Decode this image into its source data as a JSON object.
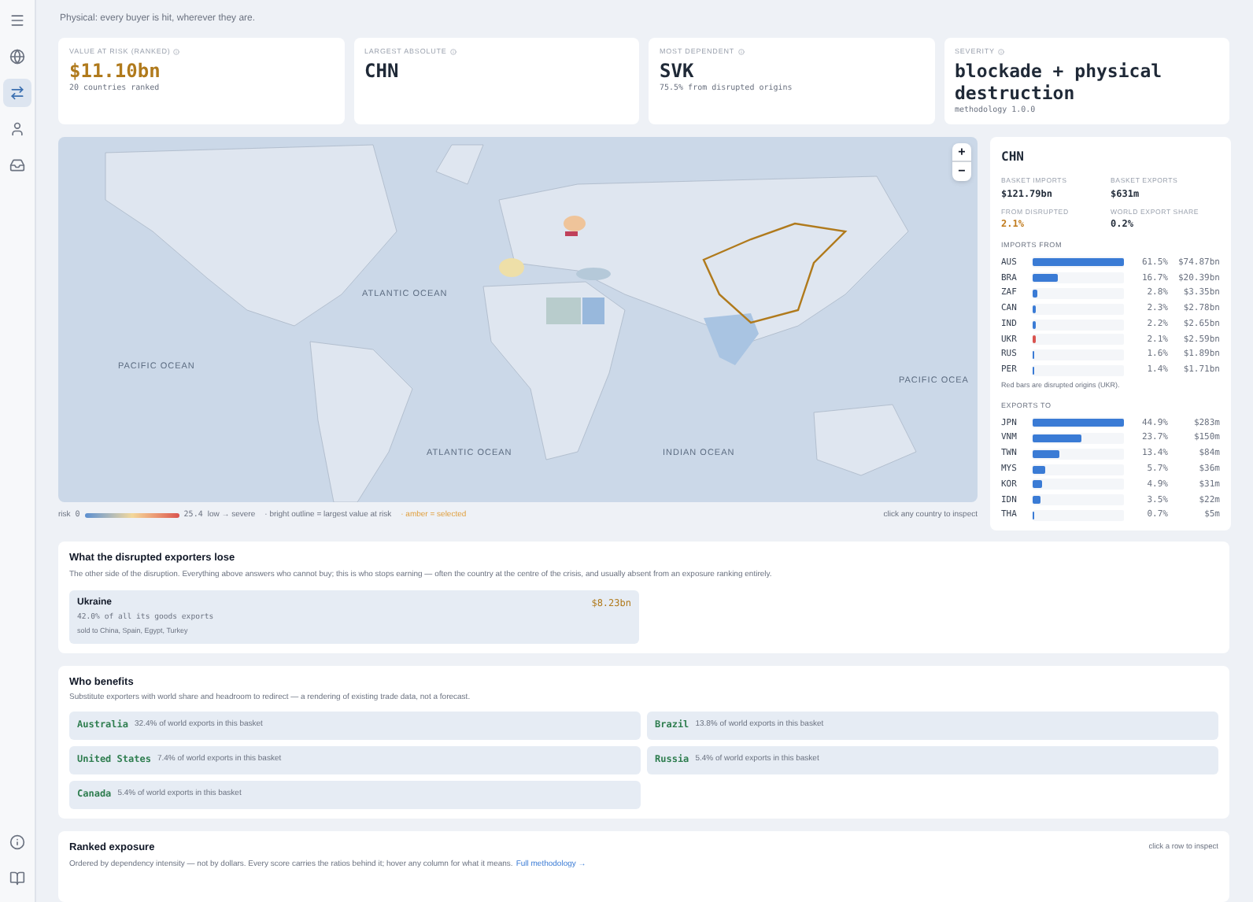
{
  "sidebar": {
    "items": [
      {
        "selected": false
      },
      {
        "selected": false
      },
      {
        "selected": true
      },
      {
        "selected": false
      },
      {
        "selected": false
      }
    ]
  },
  "intro": "Physical: every buyer is hit, wherever they are.",
  "stats": [
    {
      "label": "VALUE AT RISK (RANKED)",
      "value": "$11.10bn",
      "note": "20 countries ranked",
      "accent": true
    },
    {
      "label": "LARGEST ABSOLUTE",
      "value": "CHN",
      "accent": false
    },
    {
      "label": "MOST DEPENDENT",
      "value": "SVK",
      "note": "75.5% from disrupted origins",
      "accent": false
    },
    {
      "label": "SEVERITY",
      "value": "blockade + physical destruction",
      "note": "methodology 1.0.0",
      "accent": false
    }
  ],
  "map": {
    "zoom_in": "+",
    "zoom_out": "−",
    "oceans": [
      "ATLANTIC OCEAN",
      "PACIFIC OCEAN",
      "PACIFIC OCEA",
      "ATLANTIC OCEAN",
      "INDIAN OCEAN"
    ]
  },
  "legend": {
    "label": "risk",
    "min": "0",
    "max": "25.4",
    "scale": "low → severe",
    "outline_note": "· bright outline = largest value at risk",
    "selected_note": "· amber = selected",
    "hint": "click any country to inspect"
  },
  "detail": {
    "title": "CHN",
    "metrics": [
      {
        "label": "BASKET IMPORTS",
        "value": "$121.79bn",
        "accent": false
      },
      {
        "label": "BASKET EXPORTS",
        "value": "$631m",
        "accent": false
      },
      {
        "label": "FROM DISRUPTED",
        "value": "2.1%",
        "accent": true
      },
      {
        "label": "WORLD EXPORT SHARE",
        "value": "0.2%",
        "accent": false
      }
    ],
    "imports_title": "IMPORTS FROM",
    "imports": [
      {
        "code": "AUS",
        "level": 1.0,
        "share": "61.5%",
        "value": "$74.87bn",
        "disrupted": false
      },
      {
        "code": "BRA",
        "level": 0.27,
        "share": "16.7%",
        "value": "$20.39bn",
        "disrupted": false
      },
      {
        "code": "ZAF",
        "level": 0.05,
        "share": "2.8%",
        "value": "$3.35bn",
        "disrupted": false
      },
      {
        "code": "CAN",
        "level": 0.04,
        "share": "2.3%",
        "value": "$2.78bn",
        "disrupted": false
      },
      {
        "code": "IND",
        "level": 0.04,
        "share": "2.2%",
        "value": "$2.65bn",
        "disrupted": false
      },
      {
        "code": "UKR",
        "level": 0.04,
        "share": "2.1%",
        "value": "$2.59bn",
        "disrupted": true
      },
      {
        "code": "RUS",
        "level": 0.02,
        "share": "1.6%",
        "value": "$1.89bn",
        "disrupted": false
      },
      {
        "code": "PER",
        "level": 0.02,
        "share": "1.4%",
        "value": "$1.71bn",
        "disrupted": false
      }
    ],
    "imports_note": "Red bars are disrupted origins (UKR).",
    "exports_title": "EXPORTS TO",
    "exports": [
      {
        "code": "JPN",
        "level": 1.0,
        "share": "44.9%",
        "value": "$283m",
        "disrupted": false
      },
      {
        "code": "VNM",
        "level": 0.53,
        "share": "23.7%",
        "value": "$150m",
        "disrupted": false
      },
      {
        "code": "TWN",
        "level": 0.3,
        "share": "13.4%",
        "value": "$84m",
        "disrupted": false
      },
      {
        "code": "MYS",
        "level": 0.13,
        "share": "5.7%",
        "value": "$36m",
        "disrupted": false
      },
      {
        "code": "KOR",
        "level": 0.11,
        "share": "4.9%",
        "value": "$31m",
        "disrupted": false
      },
      {
        "code": "IDN",
        "level": 0.08,
        "share": "3.5%",
        "value": "$22m",
        "disrupted": false
      },
      {
        "code": "THA",
        "level": 0.02,
        "share": "0.7%",
        "value": "$5m",
        "disrupted": false
      }
    ]
  },
  "losers": {
    "title": "What the disrupted exporters lose",
    "description": "The other side of the disruption. Everything above answers who cannot buy; this is who stops earning — often the country at the centre of the crisis, and usually absent from an exposure ranking entirely.",
    "items": [
      {
        "country": "Ukraine",
        "value": "$8.23bn",
        "share": "42.0% of all its goods exports",
        "buyers": "sold to China, Spain, Egypt, Turkey"
      }
    ]
  },
  "beneficiaries": {
    "title": "Who benefits",
    "description": "Substitute exporters with world share and headroom to redirect — a rendering of existing trade data, not a forecast.",
    "items": [
      {
        "country": "Australia",
        "share": "32.4% of world exports in this basket"
      },
      {
        "country": "Brazil",
        "share": "13.8% of world exports in this basket"
      },
      {
        "country": "United States",
        "share": "7.4% of world exports in this basket"
      },
      {
        "country": "Russia",
        "share": "5.4% of world exports in this basket"
      },
      {
        "country": "Canada",
        "share": "5.4% of world exports in this basket"
      }
    ]
  },
  "ranked": {
    "title": "Ranked exposure",
    "hint": "click a row to inspect",
    "description": "Ordered by dependency intensity — not by dollars. Every score carries the ratios behind it; hover any column for what it means.",
    "link": "Full methodology →"
  }
}
